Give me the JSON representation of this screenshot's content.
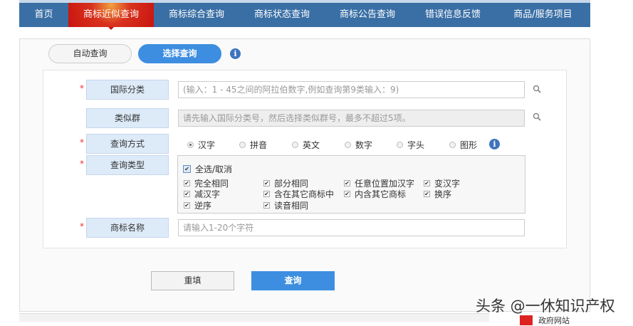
{
  "nav": {
    "items": [
      "首页",
      "商标近似查询",
      "商标综合查询",
      "商标状态查询",
      "商标公告查询",
      "错误信息反馈",
      "商品/服务项目"
    ],
    "active": 1
  },
  "mode": {
    "auto": "自动查询",
    "select": "选择查询",
    "info": "i"
  },
  "form": {
    "intl_class": {
      "label": "国际分类",
      "placeholder": "(输入：1 - 45之间的阿拉伯数字,例如查询第9类输入：9)"
    },
    "similar_group": {
      "label": "类似群",
      "placeholder": "请先输入国际分类号，然后选择类似群号，最多不超过5项。"
    },
    "query_method": {
      "label": "查询方式",
      "options": [
        "汉字",
        "拼音",
        "英文",
        "数字",
        "字头",
        "图形"
      ],
      "selected": "汉字"
    },
    "query_type": {
      "label": "查询类型",
      "select_all": "全选/取消",
      "options": [
        "完全相同",
        "部分相同",
        "任意位置加汉字",
        "变汉字",
        "减汉字",
        "含在其它商标中",
        "内含其它商标",
        "换序",
        "逆序",
        "读音相同"
      ]
    },
    "trademark_name": {
      "label": "商标名称",
      "placeholder": "请输入1-20个字符"
    },
    "required_mark": "*"
  },
  "buttons": {
    "reset": "重填",
    "query": "查询"
  },
  "footer": {
    "gov": "政府网站"
  },
  "watermark": "头条 @一休知识产权"
}
